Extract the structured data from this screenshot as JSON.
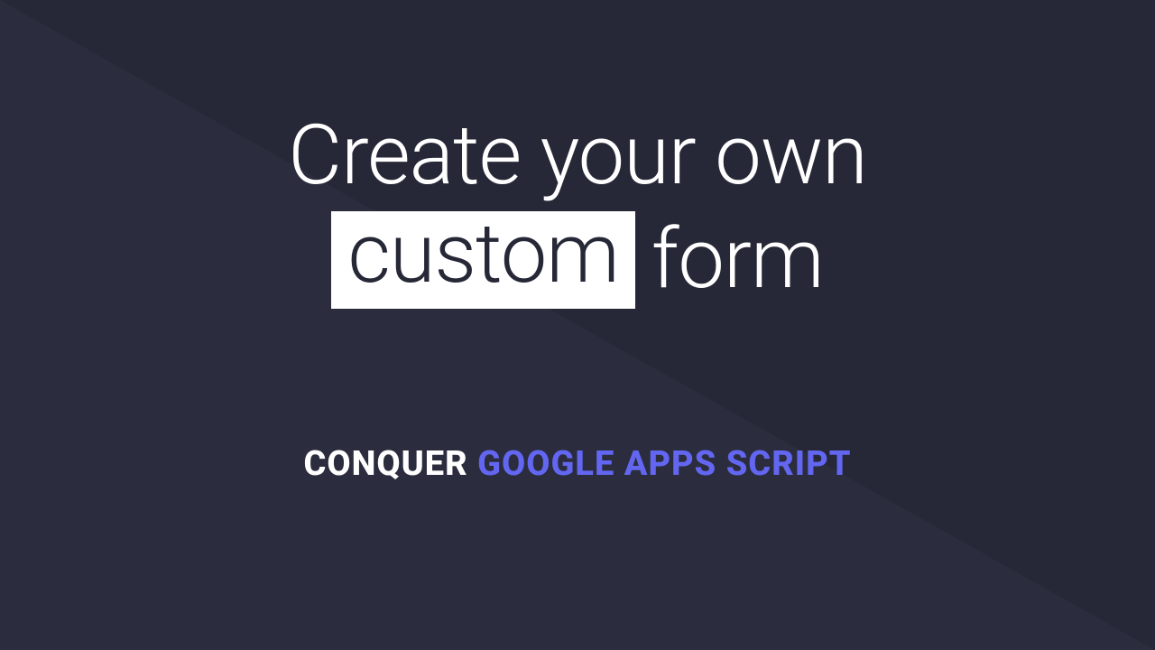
{
  "title": {
    "line1": "Create your own",
    "highlight": "custom",
    "line2_rest": "form"
  },
  "subtitle": {
    "part1": "CONQUER ",
    "part2": "GOOGLE APPS SCRIPT"
  },
  "colors": {
    "bg_light": "#2b2d3e",
    "bg_dark": "#262837",
    "text": "#ffffff",
    "accent": "#6366f1"
  }
}
